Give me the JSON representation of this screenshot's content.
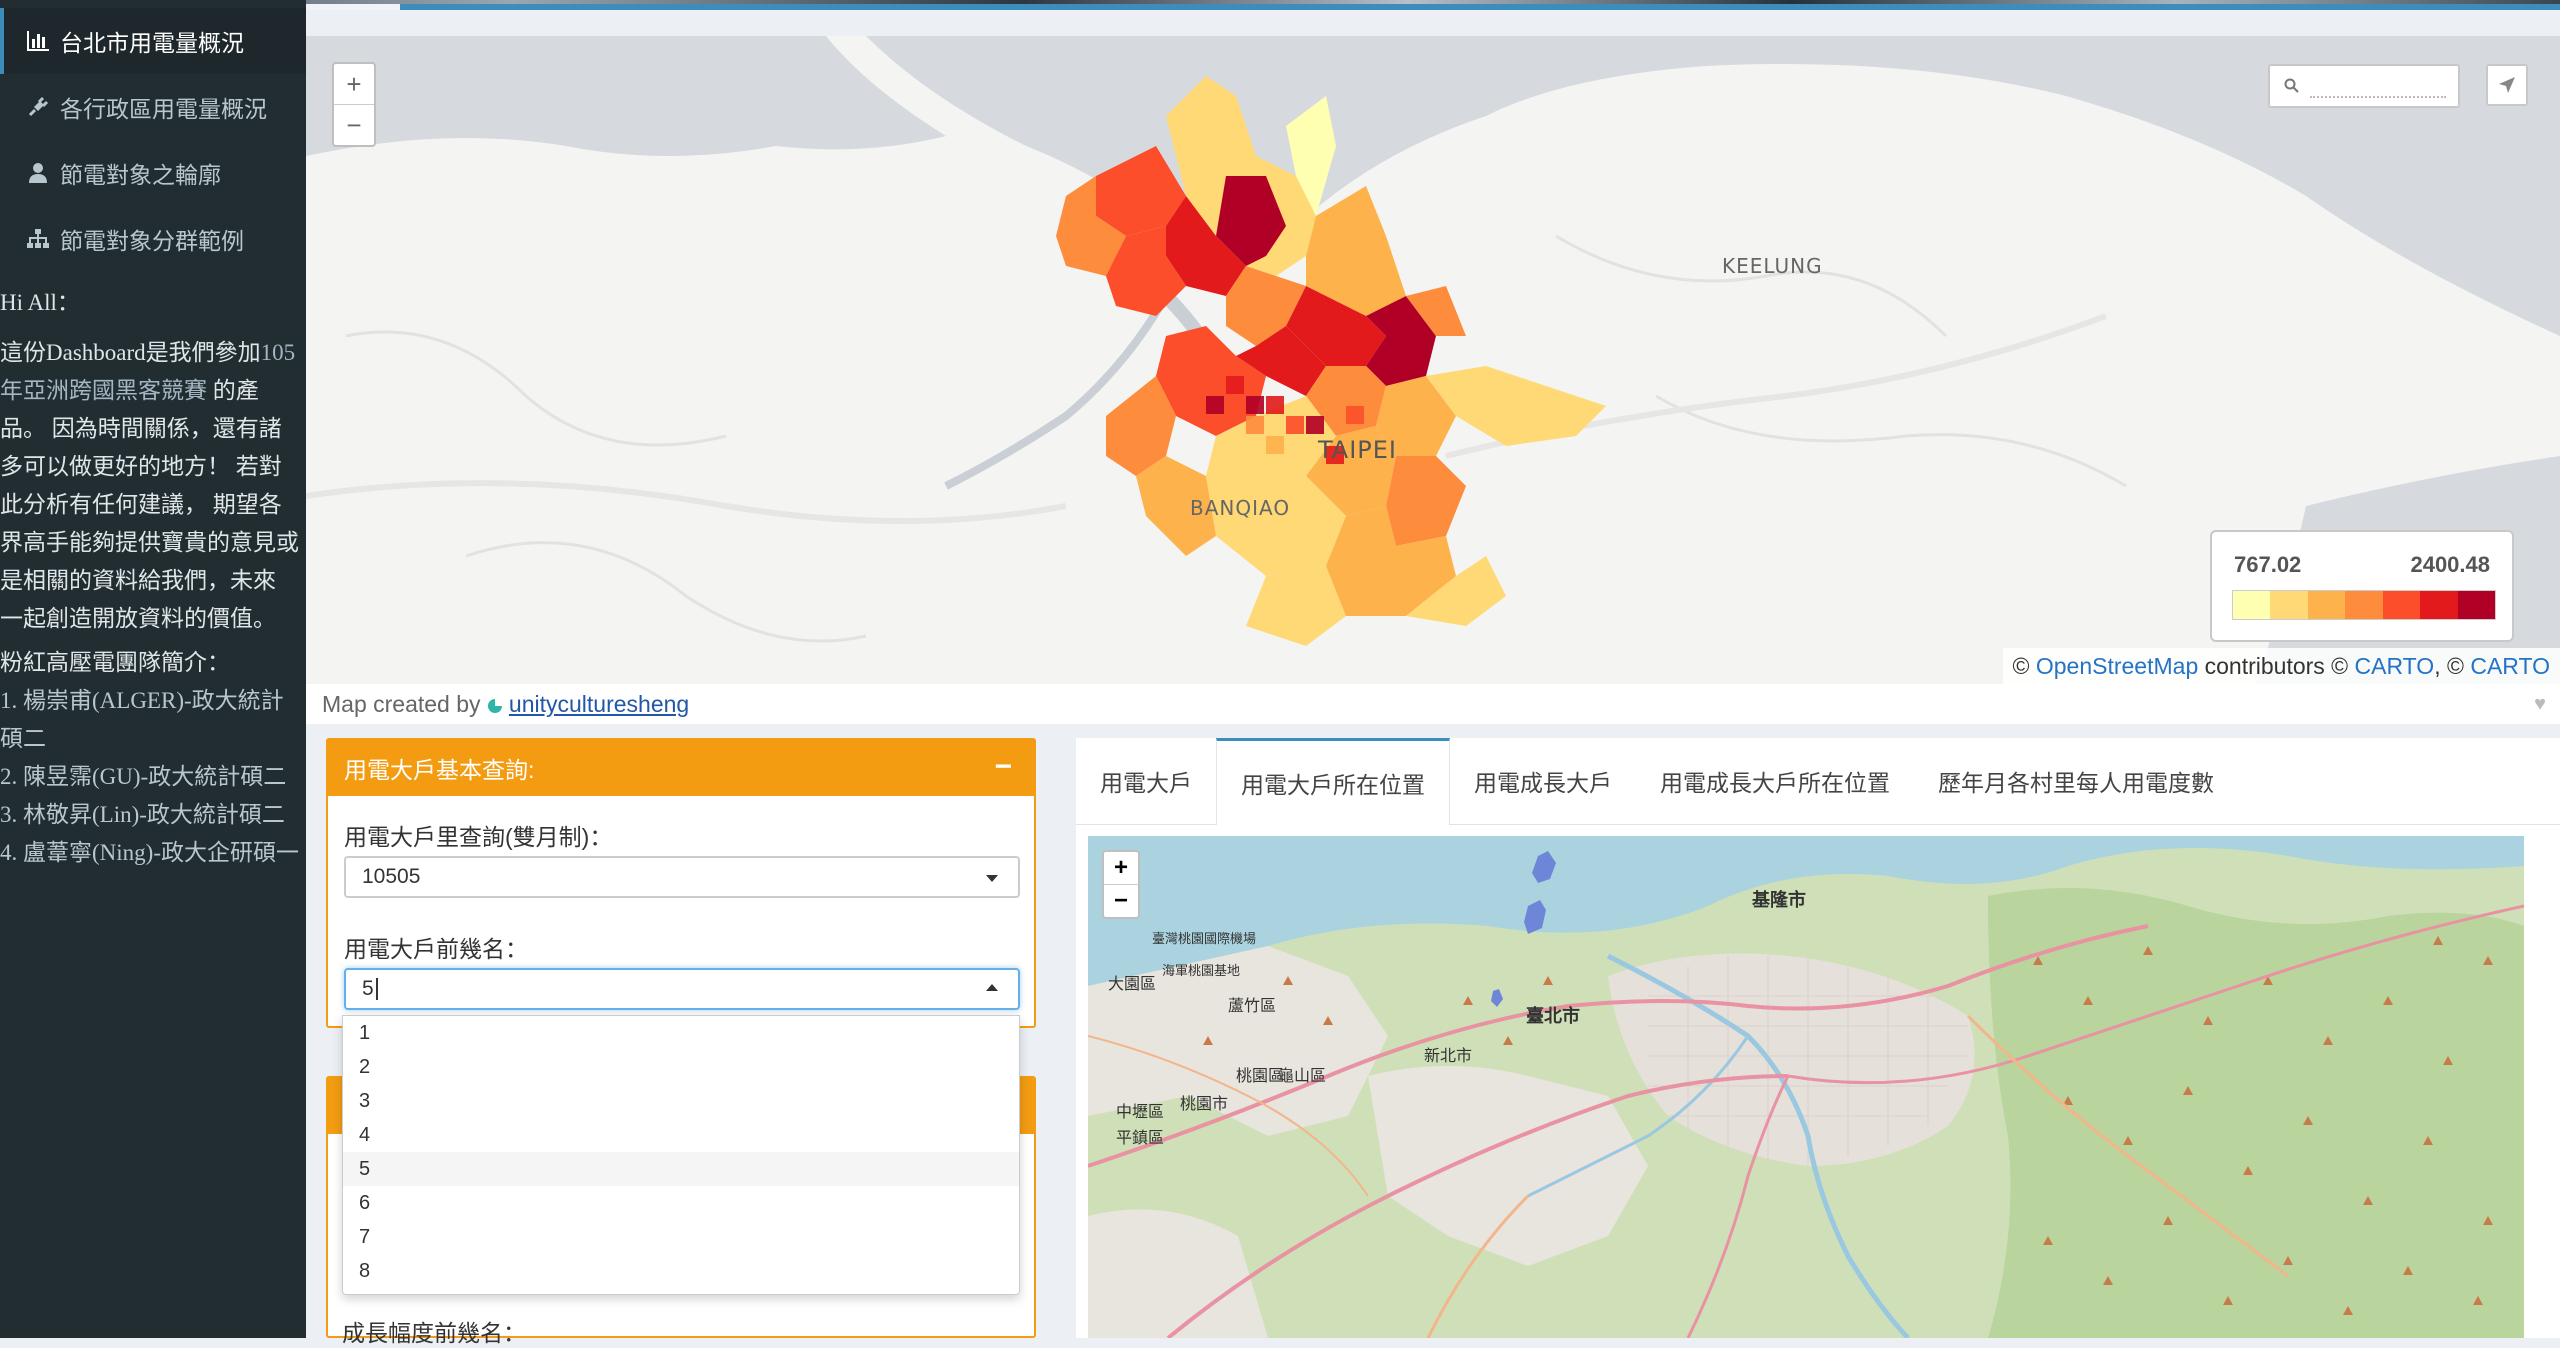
{
  "sidebar": {
    "menu": [
      {
        "label": "台北市用電量概況",
        "icon": "bar-chart-icon"
      },
      {
        "label": "各行政區用電量概況",
        "icon": "plug-icon"
      },
      {
        "label": "節電對象之輪廓",
        "icon": "user-icon"
      },
      {
        "label": "節電對象分群範例",
        "icon": "sitemap-icon"
      }
    ],
    "intro": {
      "greeting": "Hi All：",
      "text_before": "這份Dashboard是我們參加",
      "link": "105年亞洲跨國黑客競賽",
      "text_after": " 的產品。 因為時間關係，還有諸多可以做更好的地方！ 若對此分析有任何建議， 期望各界高手能夠提供寶貴的意見或是相關的資料給我們，未來 一起創造開放資料的價值。",
      "team_title": "粉紅高壓電團隊簡介：",
      "members": [
        "1. 楊崇甫(ALGER)-政大統計碩二",
        "2. 陳昱霈(GU)-政大統計碩二",
        "3. 林敬昇(Lin)-政大統計碩二",
        "4. 盧葦寧(Ning)-政大企研碩一"
      ]
    }
  },
  "top_map": {
    "zoom_in": "+",
    "zoom_out": "−",
    "labels": {
      "taipei": "TAIPEI",
      "keelung": "KEELUNG",
      "banqiao": "BANQIAO"
    },
    "legend": {
      "min": "767.02",
      "max": "2400.48",
      "colors": [
        "#ffffb2",
        "#fed976",
        "#feb24c",
        "#fd8d3c",
        "#fc4e2a",
        "#e31a1c",
        "#b10026"
      ]
    },
    "attribution": {
      "prefix": "© ",
      "osm": "OpenStreetMap",
      "mid": " contributors © ",
      "carto1": "CARTO",
      "sep": ", © ",
      "carto2": "CARTO"
    },
    "credit_prefix": "Map created by ",
    "credit_user": "unityculturesheng"
  },
  "query_box": {
    "title": "用電大戶基本查詢:",
    "collapse": "−",
    "period_label": "用電大戶里查詢(雙月制)：",
    "period_value": "10505",
    "top_n_label": "用電大戶前幾名：",
    "top_n_value": "5",
    "options": [
      "1",
      "2",
      "3",
      "4",
      "5",
      "6",
      "7",
      "8"
    ],
    "selected_option": "5",
    "growth_label": "成長幅度前幾名："
  },
  "tabs": [
    {
      "label": "用電大戶",
      "active": false
    },
    {
      "label": "用電大戶所在位置",
      "active": true
    },
    {
      "label": "用電成長大戶",
      "active": false
    },
    {
      "label": "用電成長大戶所在位置",
      "active": false
    },
    {
      "label": "歷年月各村里每人用電度數",
      "active": false
    }
  ],
  "osm_map": {
    "zoom_in": "+",
    "zoom_out": "−",
    "labels": [
      "基隆市",
      "臺北市",
      "新北市",
      "桃園市",
      "大園區",
      "蘆竹區",
      "龜山區",
      "桃園區",
      "中壢區",
      "平鎮區",
      "臺灣桃園國際機場",
      "海軍桃園基地"
    ]
  }
}
